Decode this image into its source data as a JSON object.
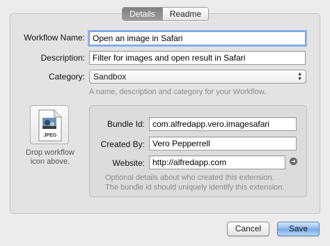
{
  "tabs": [
    {
      "label": "Details",
      "active": true
    },
    {
      "label": "Readme",
      "active": false
    }
  ],
  "form": {
    "workflow_name_label": "Workflow Name:",
    "workflow_name_value": "Open an image in Safari",
    "description_label": "Description:",
    "description_value": "Filter for images and open result in Safari",
    "category_label": "Category:",
    "category_value": "Sandbox",
    "hint": "A name, description and category for your Workflow."
  },
  "icon": {
    "file_type": "JPEG",
    "drop_text_line1": "Drop workflow",
    "drop_text_line2": "icon above."
  },
  "bundle": {
    "bundle_id_label": "Bundle Id:",
    "bundle_id_value": "com.alfredapp.vero.imagesafari",
    "created_by_label": "Created By:",
    "created_by_value": "Vero Pepperrell",
    "website_label": "Website:",
    "website_value": "http://alfredapp.com",
    "hint_line1": "Optional details about who created this extension.",
    "hint_line2": "The bundle id should uniquely identify this extension."
  },
  "buttons": {
    "cancel": "Cancel",
    "save": "Save"
  },
  "colors": {
    "focus_ring": "#8fb6ea",
    "default_button": "#74a9e7"
  }
}
